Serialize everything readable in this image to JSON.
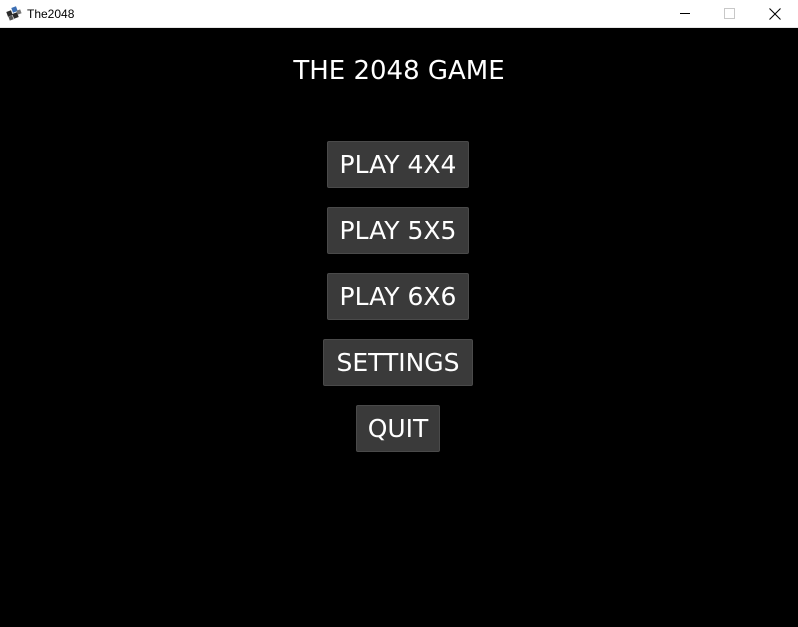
{
  "window": {
    "title": "The2048",
    "icon": "app-logo-icon",
    "controls": {
      "minimize": "minimize-icon",
      "maximize": "maximize-icon",
      "close": "close-icon"
    }
  },
  "game": {
    "title": "THE 2048 GAME"
  },
  "menu": {
    "play_4x4": "PLAY 4X4",
    "play_5x5": "PLAY 5X5",
    "play_6x6": "PLAY 6X6",
    "settings": "SETTINGS",
    "quit": "QUIT"
  },
  "colors": {
    "background": "#000000",
    "button": "#3a3a3a",
    "text": "#ffffff",
    "titlebar": "#ffffff"
  }
}
